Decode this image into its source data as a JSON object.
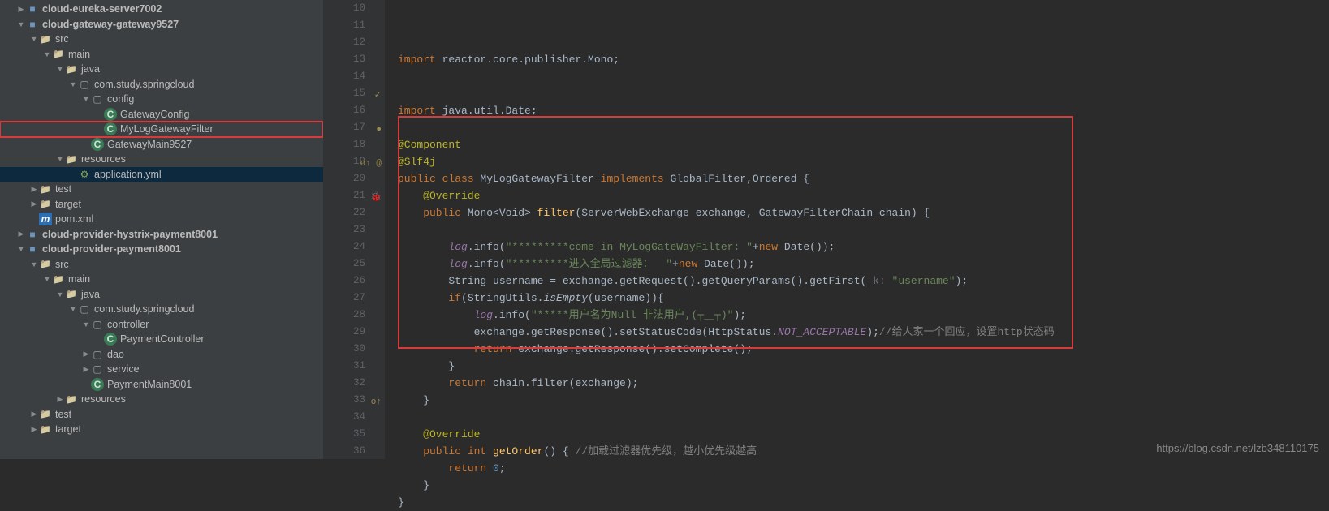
{
  "tree": [
    {
      "depth": 1,
      "arrow": "▶",
      "icon": "icon-mod",
      "label": "cloud-eureka-server7002",
      "bold": true
    },
    {
      "depth": 1,
      "arrow": "▼",
      "icon": "icon-mod",
      "label": "cloud-gateway-gateway9527",
      "bold": true
    },
    {
      "depth": 2,
      "arrow": "▼",
      "icon": "icon-folder",
      "label": "src"
    },
    {
      "depth": 3,
      "arrow": "▼",
      "icon": "icon-folder",
      "label": "main"
    },
    {
      "depth": 4,
      "arrow": "▼",
      "icon": "icon-folder",
      "label": "java"
    },
    {
      "depth": 5,
      "arrow": "▼",
      "icon": "icon-pkg",
      "label": "com.study.springcloud"
    },
    {
      "depth": 6,
      "arrow": "▼",
      "icon": "icon-pkg",
      "label": "config"
    },
    {
      "depth": 7,
      "arrow": "",
      "icon": "icon-class",
      "label": "GatewayConfig"
    },
    {
      "depth": 7,
      "arrow": "",
      "icon": "icon-class",
      "label": "MyLogGatewayFilter",
      "boxed": true
    },
    {
      "depth": 6,
      "arrow": "",
      "icon": "icon-class",
      "label": "GatewayMain9527"
    },
    {
      "depth": 4,
      "arrow": "▼",
      "icon": "icon-folder",
      "label": "resources"
    },
    {
      "depth": 5,
      "arrow": "",
      "icon": "icon-yml",
      "label": "application.yml",
      "selected": true
    },
    {
      "depth": 2,
      "arrow": "▶",
      "icon": "icon-folder",
      "label": "test"
    },
    {
      "depth": 2,
      "arrow": "▶",
      "icon": "icon-folder",
      "label": "target"
    },
    {
      "depth": 2,
      "arrow": "",
      "icon": "icon-pom",
      "label": "pom.xml"
    },
    {
      "depth": 1,
      "arrow": "▶",
      "icon": "icon-mod",
      "label": "cloud-provider-hystrix-payment8001",
      "bold": true
    },
    {
      "depth": 1,
      "arrow": "▼",
      "icon": "icon-mod",
      "label": "cloud-provider-payment8001",
      "bold": true
    },
    {
      "depth": 2,
      "arrow": "▼",
      "icon": "icon-folder",
      "label": "src"
    },
    {
      "depth": 3,
      "arrow": "▼",
      "icon": "icon-folder",
      "label": "main"
    },
    {
      "depth": 4,
      "arrow": "▼",
      "icon": "icon-folder",
      "label": "java"
    },
    {
      "depth": 5,
      "arrow": "▼",
      "icon": "icon-pkg",
      "label": "com.study.springcloud"
    },
    {
      "depth": 6,
      "arrow": "▼",
      "icon": "icon-pkg",
      "label": "controller"
    },
    {
      "depth": 7,
      "arrow": "",
      "icon": "icon-class",
      "label": "PaymentController"
    },
    {
      "depth": 6,
      "arrow": "▶",
      "icon": "icon-pkg",
      "label": "dao"
    },
    {
      "depth": 6,
      "arrow": "▶",
      "icon": "icon-pkg",
      "label": "service"
    },
    {
      "depth": 6,
      "arrow": "",
      "icon": "icon-class",
      "label": "PaymentMain8001"
    },
    {
      "depth": 4,
      "arrow": "▶",
      "icon": "icon-folder",
      "label": "resources"
    },
    {
      "depth": 2,
      "arrow": "▶",
      "icon": "icon-folder",
      "label": "test"
    },
    {
      "depth": 2,
      "arrow": "▶",
      "icon": "icon-folder",
      "label": "target"
    }
  ],
  "line_numbers": [
    "10",
    "11",
    "12",
    "13",
    "14",
    "15",
    "16",
    "17",
    "18",
    "19",
    "20",
    "21",
    "22",
    "23",
    "24",
    "25",
    "26",
    "27",
    "28",
    "29",
    "30",
    "31",
    "32",
    "33",
    "34",
    "35",
    "36"
  ],
  "gutter_marks": {
    "15": "✓",
    "17": "●",
    "19": "o↑ @",
    "21": "🐞",
    "33": "o↑"
  },
  "code": {
    "l10": {
      "t1": "import",
      "t2": " reactor.core.publisher.Mono;"
    },
    "l11": "",
    "l12": "",
    "l13": {
      "t1": "import",
      "t2": " java.util.Date;"
    },
    "l14": "",
    "l15": "@Component",
    "l16": "@Slf4j",
    "l17": {
      "t1": "public class ",
      "t2": "MyLogGatewayFilter ",
      "t3": "implements ",
      "t4": "GlobalFilter,Ordered {"
    },
    "l18": "    @Override",
    "l19": {
      "t1": "    public ",
      "t2": "Mono<Void> ",
      "t3": "filter",
      "t4": "(ServerWebExchange exchange, GatewayFilterChain chain) {"
    },
    "l20": "",
    "l21": {
      "t1": "        ",
      "t2": "log",
      "t3": ".info(",
      "t4": "\"*********come in MyLogGateWayFilter: \"",
      "t5": "+",
      "t6": "new ",
      "t7": "Date());"
    },
    "l22": {
      "t1": "        ",
      "t2": "log",
      "t3": ".info(",
      "t4": "\"*********进入全局过滤器：  \"",
      "t5": "+",
      "t6": "new ",
      "t7": "Date());"
    },
    "l23": {
      "t1": "        String username = exchange.getRequest().getQueryParams().getFirst( ",
      "t2": "k: ",
      "t3": "\"username\"",
      "t4": ");"
    },
    "l24": {
      "t1": "        if",
      "t2": "(StringUtils.",
      "t3": "isEmpty",
      "t4": "(username)){"
    },
    "l25": {
      "t1": "            ",
      "t2": "log",
      "t3": ".info(",
      "t4": "\"*****用户名为Null 非法用户,(┬＿┬)\"",
      "t5": ");"
    },
    "l26": {
      "t1": "            exchange.getResponse().setStatusCode(HttpStatus.",
      "t2": "NOT_ACCEPTABLE",
      "t3": ");",
      "t4": "//给人家一个回应，设置http状态码"
    },
    "l27": {
      "t1": "            return ",
      "t2": "exchange.getResponse().setComplete();"
    },
    "l28": "        }",
    "l29": {
      "t1": "        return ",
      "t2": "chain.filter(exchange);"
    },
    "l30": "    }",
    "l31": "",
    "l32": "    @Override",
    "l33": {
      "t1": "    public int ",
      "t2": "getOrder",
      "t3": "() { ",
      "t4": "//加载过滤器优先级，越小优先级越高"
    },
    "l34": {
      "t1": "        return ",
      "t2": "0",
      "t3": ";"
    },
    "l35": "    }",
    "l36": "}"
  },
  "watermark": "https://blog.csdn.net/lzb348110175"
}
